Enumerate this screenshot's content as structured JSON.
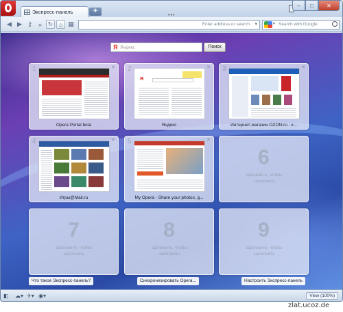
{
  "tab": {
    "label": "Экспресс-панель",
    "new_tab_symbol": "+"
  },
  "tab_dots": "•••",
  "window_controls": [
    "–",
    "□",
    "✕"
  ],
  "toolbar": {
    "address_placeholder": "Enter address or search",
    "search_placeholder": "Search with Google"
  },
  "yandex": {
    "logo": "Я",
    "placeholder": "Яндекс",
    "button": "Поиск"
  },
  "tiles": [
    {
      "num": "1",
      "caption": "Opera Portal beta"
    },
    {
      "num": "2",
      "caption": "Яндекс"
    },
    {
      "num": "3",
      "caption": "Интернет-магазин OZON.ru - к..."
    },
    {
      "num": "4",
      "caption": "Игры@Mail.ru"
    },
    {
      "num": "5",
      "caption": "My Opera - Share your photos, g..."
    },
    {
      "num": "6",
      "caption": "Щёлкните, чтобы заполнить"
    },
    {
      "num": "7",
      "caption": "Щёлкните, чтобы заполнить"
    },
    {
      "num": "8",
      "caption": "Щёлкните, чтобы заполнить"
    },
    {
      "num": "9",
      "caption": "Щёлкните, чтобы заполнить"
    }
  ],
  "bottom_links": {
    "what_is": "Что такое Экспресс-панель?",
    "sync": "Синхронизировать Opera...",
    "configure": "Настроить Экспресс-панель"
  },
  "statusbar": {
    "zoom": "View (100%)"
  },
  "watermark": "zlat.ucoz.de"
}
